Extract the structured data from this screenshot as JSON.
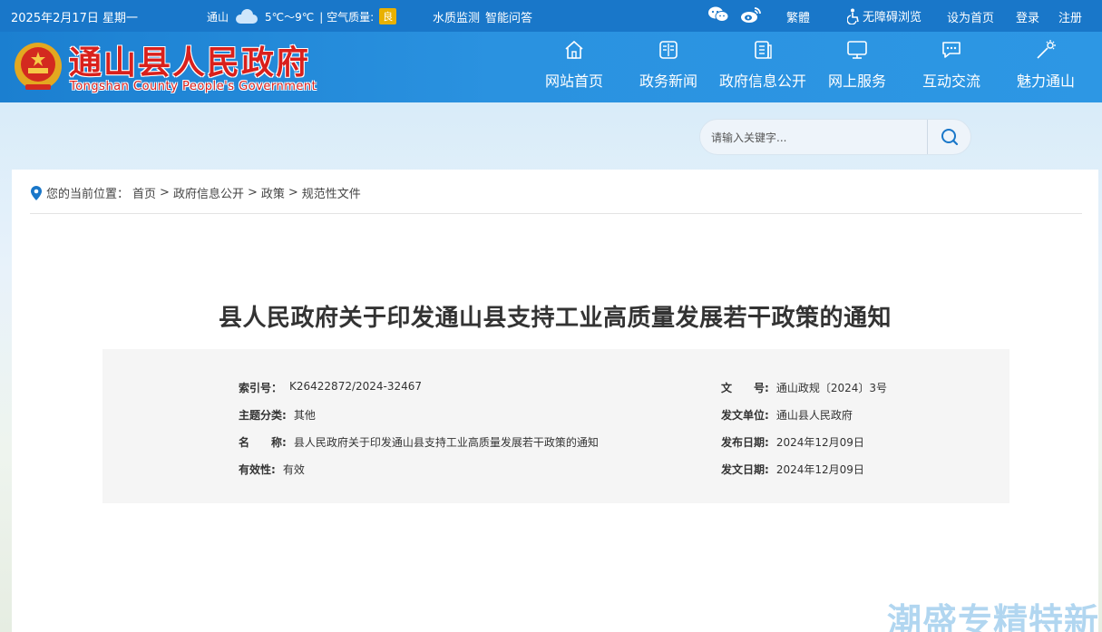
{
  "topbar": {
    "date": "2025年2月17日 星期一",
    "weather_city": "通山",
    "temperature": "5℃～9℃",
    "air_quality_label": "| 空气质量:",
    "air_quality_value": "良",
    "water_monitoring": "水质监测",
    "smart_qa": "智能问答",
    "traditional": "繁體",
    "accessibility": "无障碍浏览",
    "set_home": "设为首页",
    "login": "登录",
    "register": "注册"
  },
  "header": {
    "title": "通山县人民政府",
    "subtitle": "Tongshan County People's Government",
    "nav": [
      {
        "label": "网站首页",
        "icon": "home-icon"
      },
      {
        "label": "政务新闻",
        "icon": "news-icon"
      },
      {
        "label": "政府信息公开",
        "icon": "document-icon"
      },
      {
        "label": "网上服务",
        "icon": "monitor-icon"
      },
      {
        "label": "互动交流",
        "icon": "chat-icon"
      },
      {
        "label": "魅力通山",
        "icon": "sparkle-icon"
      }
    ]
  },
  "search": {
    "placeholder": "请输入关键字..."
  },
  "breadcrumb": {
    "prefix": "您的当前位置：",
    "items": [
      "首页",
      "政府信息公开",
      "政策",
      "规范性文件"
    ]
  },
  "document": {
    "title": "县人民政府关于印发通山县支持工业高质量发展若干政策的通知",
    "meta_left": [
      {
        "key": "索引号：",
        "value": "K26422872/2024-32467"
      },
      {
        "key": "主题分类:",
        "value": "其他"
      },
      {
        "key": "名　　称:",
        "value": "县人民政府关于印发通山县支持工业高质量发展若干政策的通知"
      },
      {
        "key": "有效性:",
        "value": "有效"
      }
    ],
    "meta_right": [
      {
        "key": "文　　号:",
        "value": "通山政规〔2024〕3号"
      },
      {
        "key": "发文单位:",
        "value": "通山县人民政府"
      },
      {
        "key": "发布日期:",
        "value": "2024年12月09日"
      },
      {
        "key": "发文日期:",
        "value": "2024年12月09日"
      }
    ]
  },
  "watermark": "潮盛专精特新"
}
